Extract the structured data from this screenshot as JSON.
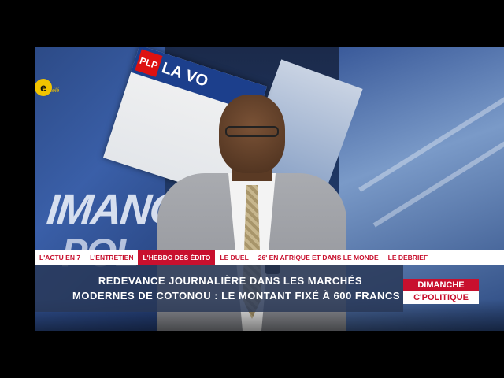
{
  "channel": {
    "logo_letter": "e",
    "logo_sub": "télé",
    "accent_color": "#f2c400"
  },
  "backdrop": {
    "paper_title": "LA VO",
    "paper_logo": "PLP",
    "wall_text_1": "IMANC",
    "wall_text_2": "POL"
  },
  "nav": {
    "items": [
      {
        "label": "L'ACTU EN 7",
        "active": false
      },
      {
        "label": "L'ENTRETIEN",
        "active": false
      },
      {
        "label": "L'HEBDO DES ÉDITO",
        "active": true
      },
      {
        "label": "LE DUEL",
        "active": false
      },
      {
        "label": "26' EN AFRIQUE ET DANS LE MONDE",
        "active": false
      },
      {
        "label": "LE DEBRIEF",
        "active": false
      }
    ],
    "accent_color": "#c8102e"
  },
  "headline": {
    "line1": "REDEVANCE JOURNALIÈRE DANS LES MARCHÉS",
    "line2": "MODERNES DE COTONOU : LE MONTANT FIXÉ À 600 FRANCS"
  },
  "show": {
    "line1": "DIMANCHE",
    "line2": "C'POLITIQUE"
  }
}
